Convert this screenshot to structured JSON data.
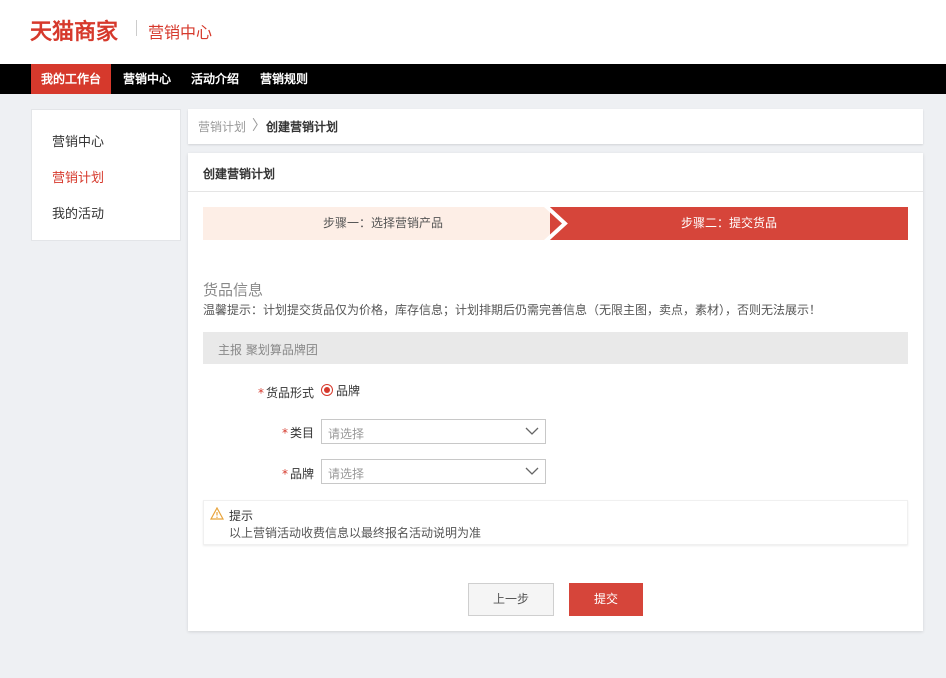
{
  "header": {
    "logo": "天猫商家",
    "subtitle": "营销中心"
  },
  "nav": {
    "items": [
      {
        "label": "我的工作台",
        "active": true
      },
      {
        "label": "营销中心",
        "active": false
      },
      {
        "label": "活动介绍",
        "active": false
      },
      {
        "label": "营销规则",
        "active": false
      }
    ]
  },
  "sidebar": {
    "items": [
      {
        "label": "营销中心",
        "active": false
      },
      {
        "label": "营销计划",
        "active": true
      },
      {
        "label": "我的活动",
        "active": false
      }
    ]
  },
  "breadcrumb": {
    "parent": "营销计划",
    "separator": "〉",
    "current": "创建营销计划"
  },
  "panel": {
    "title": "创建营销计划",
    "steps": [
      {
        "label": "步骤一：选择营销产品",
        "active": false
      },
      {
        "label": "步骤二：提交货品",
        "active": true
      }
    ],
    "section_heading": "货品信息",
    "tip": "温馨提示：计划提交货品仅为价格，库存信息；计划排期后仍需完善信息（无限主图，卖点，素材），否则无法展示！",
    "group_label": "主报 聚划算品牌团",
    "form": {
      "required_mark": "*",
      "goods_form_label": "货品形式",
      "goods_form_option": "品牌",
      "category_label": "类目",
      "category_placeholder": "请选择",
      "brand_label": "品牌",
      "brand_placeholder": "请选择"
    },
    "notice": {
      "title": "提示",
      "body": "以上营销活动收费信息以最终报名活动说明为准"
    },
    "buttons": {
      "prev": "上一步",
      "submit": "提交"
    }
  },
  "colors": {
    "accent": "#d6392c",
    "step_active": "#d6453a",
    "step_inactive": "#fdeee6"
  }
}
